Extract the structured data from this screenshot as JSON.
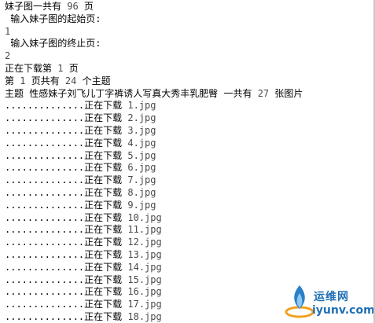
{
  "console": {
    "lines": [
      {
        "segments": [
          {
            "t": "妹子图一共有 "
          },
          {
            "t": "96",
            "n": true
          },
          {
            "t": " 页"
          }
        ]
      },
      {
        "segments": [
          {
            "t": " 输入妹子图的起始页:"
          }
        ]
      },
      {
        "segments": [
          {
            "t": "1",
            "n": true
          }
        ]
      },
      {
        "segments": [
          {
            "t": " 输入妹子图的终止页:"
          }
        ]
      },
      {
        "segments": [
          {
            "t": "2",
            "n": true
          }
        ]
      },
      {
        "segments": [
          {
            "t": "正在下载第 "
          },
          {
            "t": "1",
            "n": true
          },
          {
            "t": " 页"
          }
        ]
      },
      {
        "segments": [
          {
            "t": "第 "
          },
          {
            "t": "1",
            "n": true
          },
          {
            "t": " 页共有 "
          },
          {
            "t": "24",
            "n": true
          },
          {
            "t": " 个主题"
          }
        ]
      },
      {
        "segments": [
          {
            "t": "主题 性感妹子刘飞儿丁字裤诱人写真大秀丰乳肥臀 一共有 "
          },
          {
            "t": "27",
            "n": true
          },
          {
            "t": " 张图片"
          }
        ]
      },
      {
        "segments": [
          {
            "t": "..............正在下载 "
          },
          {
            "t": "1.jpg",
            "n": true
          }
        ]
      },
      {
        "segments": [
          {
            "t": "..............正在下载 "
          },
          {
            "t": "2.jpg",
            "n": true
          }
        ]
      },
      {
        "segments": [
          {
            "t": "..............正在下载 "
          },
          {
            "t": "3.jpg",
            "n": true
          }
        ]
      },
      {
        "segments": [
          {
            "t": "..............正在下载 "
          },
          {
            "t": "4.jpg",
            "n": true
          }
        ]
      },
      {
        "segments": [
          {
            "t": "..............正在下载 "
          },
          {
            "t": "5.jpg",
            "n": true
          }
        ]
      },
      {
        "segments": [
          {
            "t": "..............正在下载 "
          },
          {
            "t": "6.jpg",
            "n": true
          }
        ]
      },
      {
        "segments": [
          {
            "t": "..............正在下载 "
          },
          {
            "t": "7.jpg",
            "n": true
          }
        ]
      },
      {
        "segments": [
          {
            "t": "..............正在下载 "
          },
          {
            "t": "8.jpg",
            "n": true
          }
        ]
      },
      {
        "segments": [
          {
            "t": "..............正在下载 "
          },
          {
            "t": "9.jpg",
            "n": true
          }
        ]
      },
      {
        "segments": [
          {
            "t": "..............正在下载 "
          },
          {
            "t": "10.jpg",
            "n": true
          }
        ]
      },
      {
        "segments": [
          {
            "t": "..............正在下载 "
          },
          {
            "t": "11.jpg",
            "n": true
          }
        ]
      },
      {
        "segments": [
          {
            "t": "..............正在下载 "
          },
          {
            "t": "12.jpg",
            "n": true
          }
        ]
      },
      {
        "segments": [
          {
            "t": "..............正在下载 "
          },
          {
            "t": "13.jpg",
            "n": true
          }
        ]
      },
      {
        "segments": [
          {
            "t": "..............正在下载 "
          },
          {
            "t": "14.jpg",
            "n": true
          }
        ]
      },
      {
        "segments": [
          {
            "t": "..............正在下载 "
          },
          {
            "t": "15.jpg",
            "n": true
          }
        ]
      },
      {
        "segments": [
          {
            "t": "..............正在下载 "
          },
          {
            "t": "16.jpg",
            "n": true
          }
        ]
      },
      {
        "segments": [
          {
            "t": "..............正在下载 "
          },
          {
            "t": "17.jpg",
            "n": true
          }
        ]
      },
      {
        "segments": [
          {
            "t": "..............正在下载 "
          },
          {
            "t": "18.jpg",
            "n": true
          }
        ]
      }
    ]
  },
  "watermark": {
    "text_cn": "运维网",
    "text_en": "iyunv.com",
    "color": "#1f6fb5",
    "icon": "flame-logo-icon"
  }
}
